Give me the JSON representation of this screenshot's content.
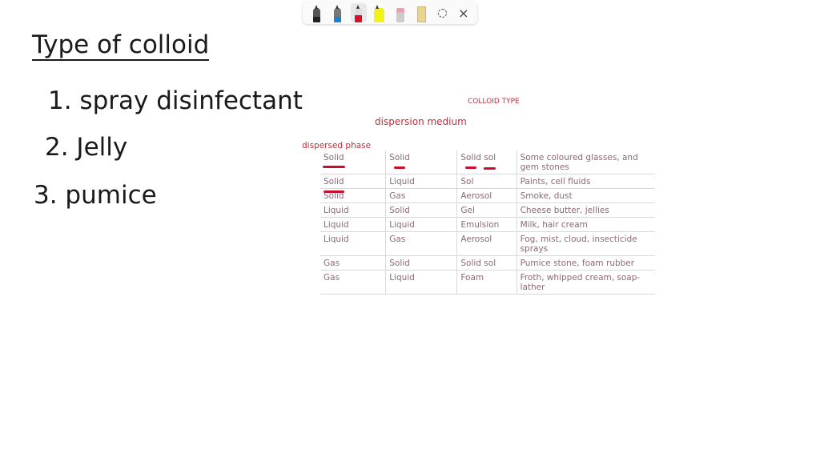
{
  "toolbar": {
    "tools": [
      {
        "name": "black-pen",
        "color": "#222222"
      },
      {
        "name": "blue-pen",
        "color": "#1e7fd0"
      },
      {
        "name": "red-pen",
        "color": "#d8102a",
        "selected": true
      },
      {
        "name": "highlighter",
        "color": "#f2f21a"
      },
      {
        "name": "eraser",
        "color": "#e6a0b0"
      },
      {
        "name": "ruler",
        "color": "#e8d590"
      },
      {
        "name": "lasso"
      },
      {
        "name": "close"
      }
    ],
    "close_glyph": "×"
  },
  "notes": {
    "title": "Type of colloid",
    "items": [
      "1. spray disinfectant",
      "2. Jelly",
      "3. pumice"
    ]
  },
  "annotations": {
    "colloid_type": "COLLOID TYPE",
    "dispersion_medium": "dispersion medium",
    "dispersed_phase": "dispersed phase",
    "ink_color": "#c8102e"
  },
  "table": {
    "rows": [
      [
        "Solid",
        "Solid",
        "Solid sol",
        "Some coloured glasses, and gem stones"
      ],
      [
        "Solid",
        "Liquid",
        "Sol",
        "Paints, cell fluids"
      ],
      [
        "Solid",
        "Gas",
        "Aerosol",
        "Smoke, dust"
      ],
      [
        "Liquid",
        "Solid",
        "Gel",
        "Cheese butter, jellies"
      ],
      [
        "Liquid",
        "Liquid",
        "Emulsion",
        "Milk, hair cream"
      ],
      [
        "Liquid",
        "Gas",
        "Aerosol",
        "Fog, mist, cloud, insecticide sprays"
      ],
      [
        "Gas",
        "Solid",
        "Solid sol",
        "Pumice stone, foam rubber"
      ],
      [
        "Gas",
        "Liquid",
        "Foam",
        "Froth, whipped cream, soap-lather"
      ]
    ]
  }
}
